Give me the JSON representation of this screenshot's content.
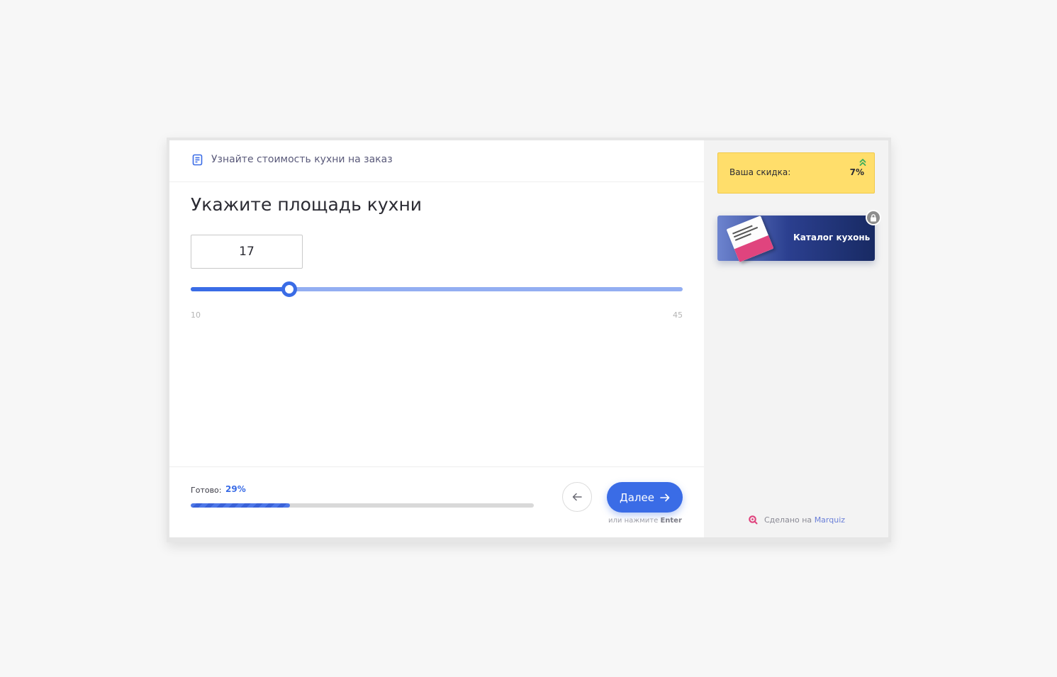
{
  "header": {
    "title": "Узнайте стоимость кухни на заказ",
    "icon": "document-list-icon"
  },
  "question": {
    "title": "Укажите площадь кухни",
    "value": "17",
    "slider": {
      "min": "10",
      "max": "45",
      "current": 17,
      "min_value": 10,
      "max_value": 45
    }
  },
  "footer": {
    "progress_label": "Готово:",
    "progress_value": "29%",
    "progress_fraction": 0.29,
    "next_label": "Далее",
    "hint_prefix": "или нажмите",
    "hint_key": "Enter"
  },
  "sidebar": {
    "discount_label": "Ваша скидка:",
    "discount_value": "7%",
    "catalog_label": "Каталог кухонь",
    "made_with_prefix": "Сделано на",
    "made_with_brand": "Marquiz"
  },
  "colors": {
    "accent": "#3a6ce6",
    "track": "#93aef2",
    "discount_bg": "#ffde6b",
    "catalog_dark": "#182a63"
  }
}
